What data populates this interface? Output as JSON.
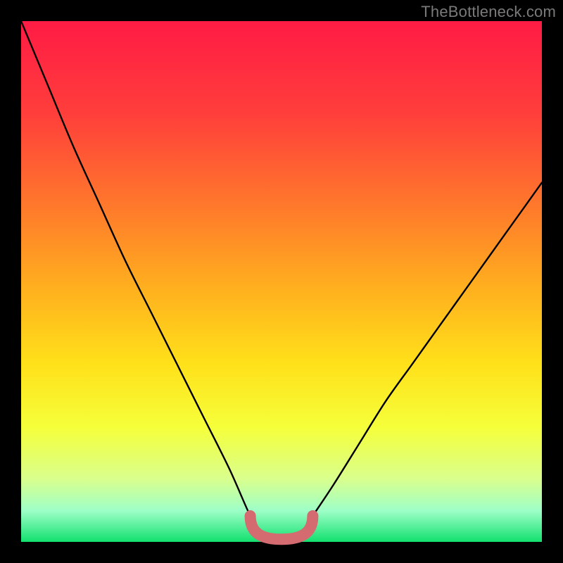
{
  "watermark": "TheBottleneck.com",
  "colors": {
    "bg_black": "#000000",
    "curve": "#000000",
    "trough_marker": "#d46b71",
    "watermark_text": "#7a7a7a",
    "gradient_stops": [
      {
        "offset": 0.0,
        "color": "#ff1b45"
      },
      {
        "offset": 0.18,
        "color": "#ff3f3b"
      },
      {
        "offset": 0.36,
        "color": "#ff7a2b"
      },
      {
        "offset": 0.52,
        "color": "#ffb21e"
      },
      {
        "offset": 0.66,
        "color": "#ffe11a"
      },
      {
        "offset": 0.78,
        "color": "#f5ff3a"
      },
      {
        "offset": 0.88,
        "color": "#d9ff8e"
      },
      {
        "offset": 0.94,
        "color": "#9effc8"
      },
      {
        "offset": 1.0,
        "color": "#12e06e"
      }
    ]
  },
  "chart_data": {
    "type": "line",
    "title": "",
    "xlabel": "",
    "ylabel": "",
    "xlim": [
      0,
      100
    ],
    "ylim": [
      0,
      100
    ],
    "x": [
      0,
      5,
      10,
      15,
      20,
      25,
      30,
      35,
      40,
      44,
      46,
      48,
      50,
      52,
      54,
      56,
      60,
      65,
      70,
      75,
      80,
      85,
      90,
      95,
      100
    ],
    "series": [
      {
        "name": "bottleneck-curve",
        "values": [
          100,
          88,
          76,
          65,
          54,
          44,
          34,
          24,
          14,
          5,
          2,
          0.8,
          0.5,
          0.8,
          2,
          5,
          11,
          19,
          27,
          34,
          41,
          48,
          55,
          62,
          69
        ]
      }
    ],
    "trough_marker": {
      "x_start": 44,
      "x_end": 56,
      "y": 1.5
    },
    "annotations": []
  }
}
